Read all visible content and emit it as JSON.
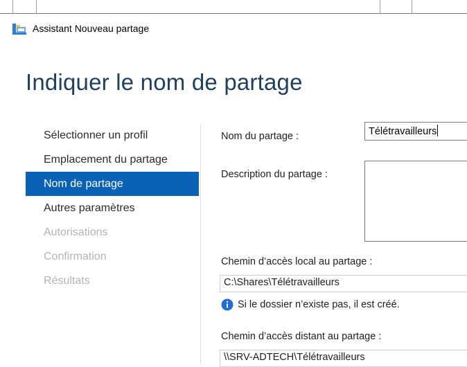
{
  "window": {
    "title": "Assistant Nouveau partage"
  },
  "page": {
    "title": "Indiquer le nom de partage"
  },
  "nav": {
    "items": [
      {
        "label": "Sélectionner un profil",
        "state": "normal"
      },
      {
        "label": "Emplacement du partage",
        "state": "normal"
      },
      {
        "label": "Nom de partage",
        "state": "active"
      },
      {
        "label": "Autres paramètres",
        "state": "normal"
      },
      {
        "label": "Autorisations",
        "state": "disabled"
      },
      {
        "label": "Confirmation",
        "state": "disabled"
      },
      {
        "label": "Résultats",
        "state": "disabled"
      }
    ]
  },
  "form": {
    "share_name_label": "Nom du partage :",
    "share_name_value": "Télétravailleurs",
    "description_label": "Description du partage :",
    "description_value": "",
    "local_path_label": "Chemin d’accès local au partage :",
    "local_path_value": "C:\\Shares\\Télétravailleurs",
    "info_text": "Si le dossier n’existe pas, il est créé.",
    "remote_path_label": "Chemin d’accès distant au partage :",
    "remote_path_value": "\\\\SRV-ADTECH\\Télétravailleurs"
  },
  "colors": {
    "accent": "#0a62b7",
    "title": "#1e3f5e",
    "disabled_text": "#b4b4b4"
  },
  "icons": {
    "app": "share-wizard-icon",
    "info": "info-icon"
  }
}
